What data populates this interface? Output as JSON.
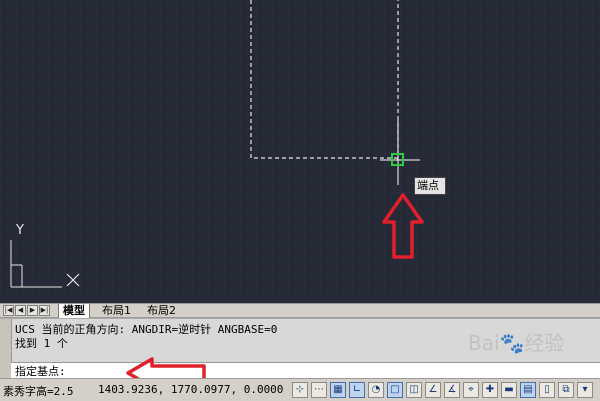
{
  "canvas": {
    "osnap_tooltip": "端点",
    "ucs_axis_y": "Y",
    "ucs_axis_x": "X"
  },
  "tabs": {
    "items": [
      {
        "label": "模型",
        "active": true
      },
      {
        "label": "布局1",
        "active": false
      },
      {
        "label": "布局2",
        "active": false
      }
    ]
  },
  "command_window": {
    "history_line_1": "UCS 当前的正角方向:  ANGDIR=逆时针   ANGBASE=0",
    "history_line_2": "找到 1 个",
    "prompt": "指定基点:"
  },
  "status_bar": {
    "text_height_label": "素秀字高=2.5",
    "coordinates": "1403.9236, 1770.0977, 0.0000"
  },
  "watermark": "Bai🐾经验",
  "colors": {
    "canvas_bg": "#252a36",
    "dash_line": "#e0e0e0",
    "osnap_marker": "#2ecc40",
    "annotation_arrow": "#e0202a"
  }
}
